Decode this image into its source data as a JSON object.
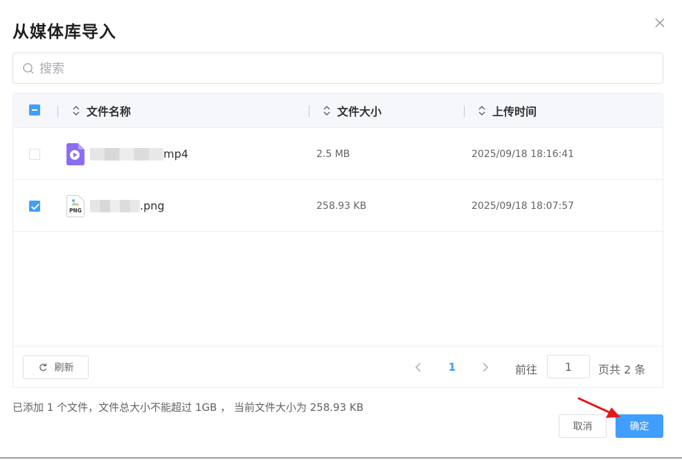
{
  "dialog": {
    "title": "从媒体库导入",
    "search_placeholder": "搜索"
  },
  "table": {
    "columns": [
      "文件名称",
      "文件大小",
      "上传时间"
    ],
    "rows": [
      {
        "name_suffix": "mp4",
        "size": "2.5 MB",
        "time": "2025/09/18 18:16:41",
        "checked": false,
        "icon": "video-file-icon"
      },
      {
        "name_suffix": ".png",
        "size": "258.93 KB",
        "time": "2025/09/18 18:07:57",
        "checked": true,
        "icon": "png-file-icon",
        "icon_label": "PNG"
      }
    ]
  },
  "pagination": {
    "refresh_label": "刷新",
    "current_page": "1",
    "goto_label": "前往",
    "goto_value": "1",
    "total_label": "页共 2 条"
  },
  "footer": {
    "status": "已添加 1 个文件，文件总大小不能超过 1GB ， 当前文件大小为 258.93 KB",
    "cancel_label": "取消",
    "confirm_label": "确定"
  },
  "colors": {
    "primary": "#409eff",
    "video_icon": "#8c6cf0",
    "annotation_arrow": "#e8141a"
  }
}
